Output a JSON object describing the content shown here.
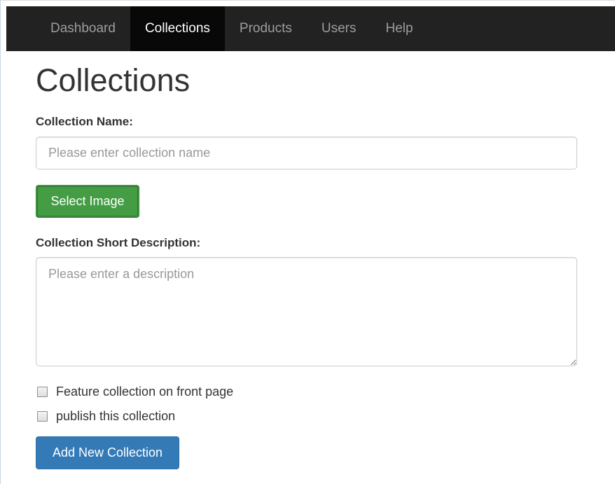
{
  "navbar": {
    "items": [
      {
        "label": "Dashboard",
        "active": false
      },
      {
        "label": "Collections",
        "active": true
      },
      {
        "label": "Products",
        "active": false
      },
      {
        "label": "Users",
        "active": false
      },
      {
        "label": "Help",
        "active": false
      }
    ]
  },
  "page": {
    "title": "Collections"
  },
  "form": {
    "name_label": "Collection Name:",
    "name_value": "",
    "name_placeholder": "Please enter collection name",
    "select_image_label": "Select Image",
    "description_label": "Collection Short Description:",
    "description_value": "",
    "description_placeholder": "Please enter a description",
    "feature_checkbox_label": "Feature collection on front page",
    "feature_checked": false,
    "publish_checkbox_label": "publish this collection",
    "publish_checked": false,
    "submit_label": "Add New Collection"
  },
  "colors": {
    "navbar_bg": "#222222",
    "navbar_active_bg": "#080808",
    "success": "#449d44",
    "primary": "#337ab7"
  }
}
